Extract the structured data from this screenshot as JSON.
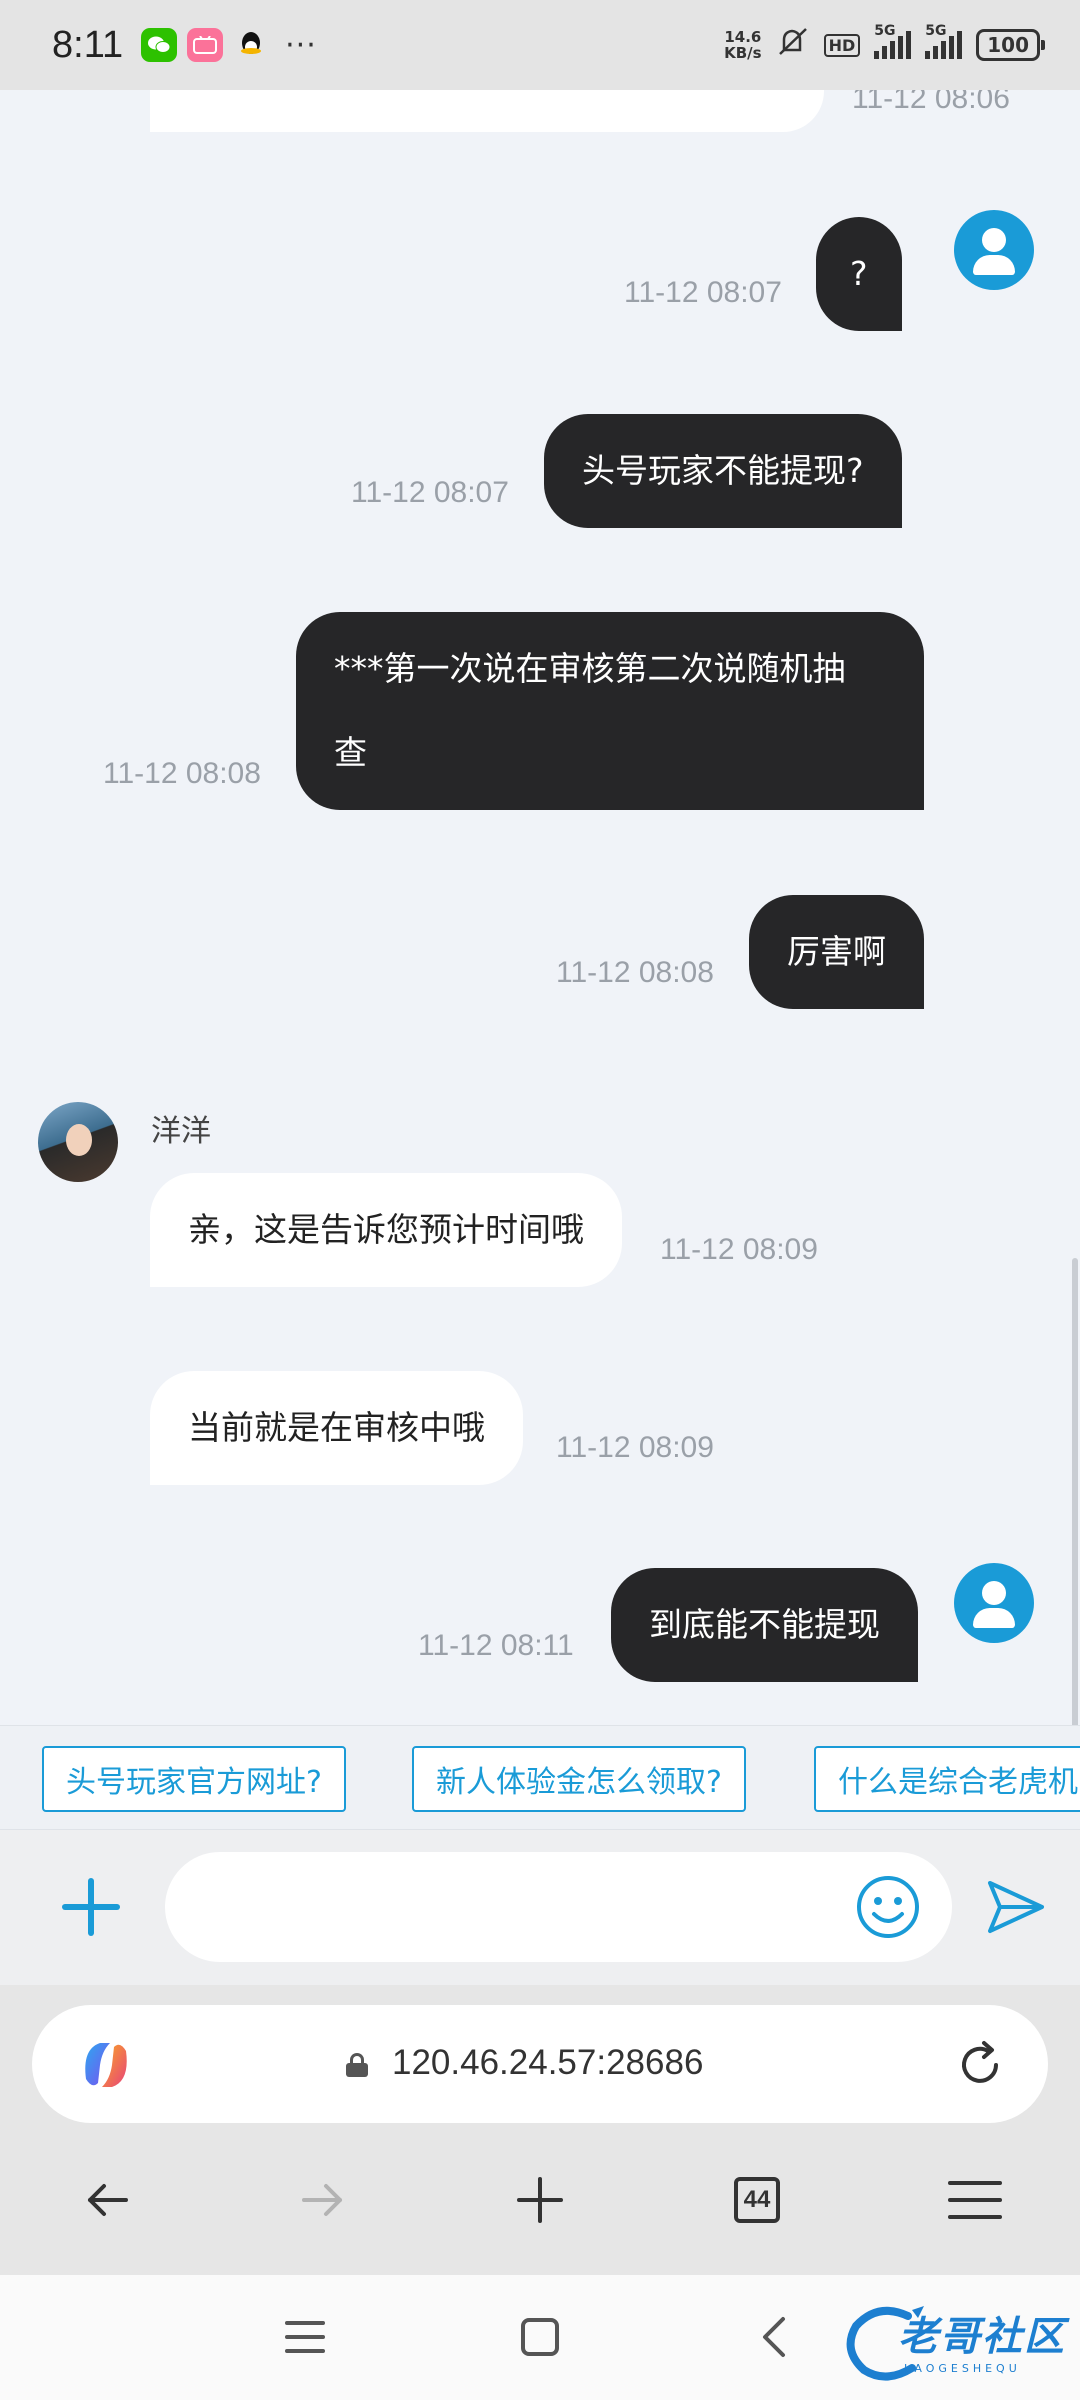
{
  "status_bar": {
    "time": "8:11",
    "more": "···",
    "speed_value": "14.6",
    "speed_unit": "KB/s",
    "network_1": "5G",
    "network_2": "5G",
    "battery": "100"
  },
  "chat": {
    "agent_name": "洋洋",
    "messages": [
      {
        "side": "out",
        "text": "?",
        "time": "11-12 08:07"
      },
      {
        "side": "out",
        "text": "头号玩家不能提现?",
        "time": "11-12 08:07"
      },
      {
        "side": "out",
        "text_line1": "***第一次说在审核第二次说随机抽",
        "text_line2": "查",
        "time": "11-12 08:08"
      },
      {
        "side": "out",
        "text": "厉害啊",
        "time": "11-12 08:08"
      },
      {
        "side": "in",
        "text": "亲，这是告诉您预计时间哦",
        "time": "11-12 08:09"
      },
      {
        "side": "in",
        "text": "当前就是在审核中哦",
        "time": "11-12 08:09"
      },
      {
        "side": "out",
        "text": "到底能不能提现",
        "time": "11-12 08:11"
      }
    ],
    "partial_top_time": "11-12 08:06"
  },
  "quick_replies": [
    "头号玩家官方网址?",
    "新人体验金怎么领取?",
    "什么是综合老虎机"
  ],
  "input": {
    "placeholder": "",
    "value": ""
  },
  "browser": {
    "url": "120.46.24.57:28686",
    "tab_count": "44"
  },
  "watermark": {
    "text": "老哥社区",
    "sub": "LAOGESHEQU"
  },
  "colors": {
    "accent": "#1a9bd7",
    "bubble_out": "#262628",
    "bubble_in": "#ffffff",
    "chat_bg": "#f0f3f8"
  }
}
